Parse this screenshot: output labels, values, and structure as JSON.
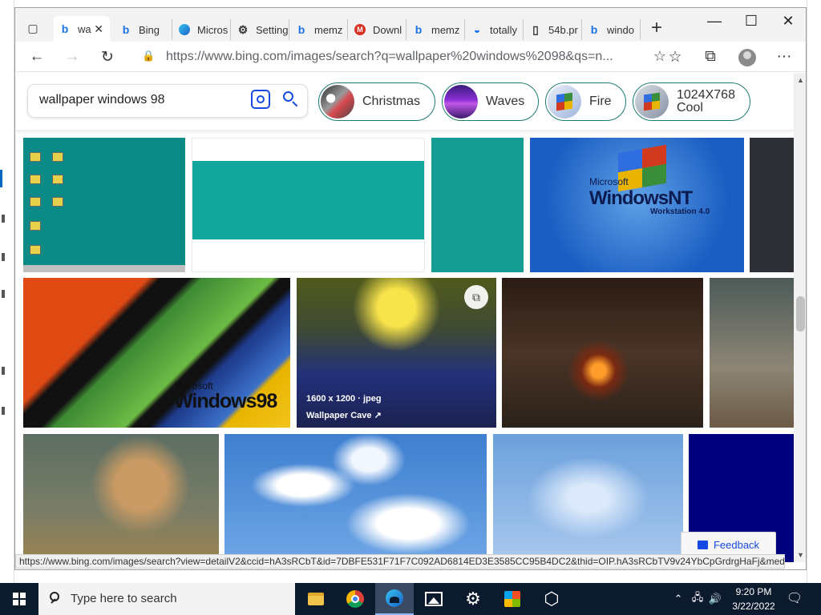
{
  "browser": {
    "tabs": [
      {
        "label": "wa",
        "icon": "bing-icon",
        "active": true,
        "close": "✕"
      },
      {
        "label": "Bing",
        "icon": "bing-icon"
      },
      {
        "label": "Micros",
        "icon": "edge-icon"
      },
      {
        "label": "Setting",
        "icon": "gear-icon"
      },
      {
        "label": "memz",
        "icon": "bing-icon"
      },
      {
        "label": "Downl",
        "icon": "gmail-icon"
      },
      {
        "label": "memz",
        "icon": "bing-icon"
      },
      {
        "label": "totally",
        "icon": "sync-icon"
      },
      {
        "label": "54b.pr",
        "icon": "document-icon"
      },
      {
        "label": "windo",
        "icon": "bing-icon"
      }
    ],
    "new_tab": "+",
    "window_controls": {
      "minimize": "—",
      "maximize": "☐",
      "close": "✕"
    },
    "address": {
      "url": "https://www.bing.com/images/search?q=wallpaper%20windows%2098&qs=n...",
      "lock": "🔒"
    }
  },
  "page": {
    "search": {
      "query": "wallpaper windows 98"
    },
    "chips": [
      {
        "label": "Christmas",
        "thumb": "christmas"
      },
      {
        "label": "Waves",
        "thumb": "waves"
      },
      {
        "label": "Fire",
        "thumb": "fire"
      },
      {
        "label": "1024X768 Cool",
        "line1": "1024X768",
        "line2": "Cool",
        "thumb": "cool"
      }
    ],
    "tiles": {
      "nt": {
        "brand": "Microsoft",
        "title": "WindowsNT",
        "sub": "Workstation 4.0"
      },
      "w98": {
        "brand": "Microsoft",
        "title": "Windows98"
      },
      "hover": {
        "size": "1600 x 1200 · jpeg",
        "source": "Wallpaper Cave"
      }
    },
    "feedback": "Feedback",
    "status_url": "https://www.bing.com/images/search?view=detailV2&ccid=hA3sRCbT&id=7DBFE531F71F7C092AD6814ED3E3585CC95B4DC2&thid=OIP.hA3sRCbTV9v24YbCpGrdrgHaFj&medi..."
  },
  "taskbar": {
    "search_placeholder": "Type here to search",
    "apps": [
      "file-explorer-icon",
      "chrome-icon",
      "edge-icon",
      "photos-icon",
      "settings-icon",
      "store-icon",
      "3d-viewer-icon"
    ],
    "time": "9:20 PM",
    "date": "3/22/2022"
  },
  "colors": {
    "bing_blue": "#174ae4",
    "chip_border": "#1c7a74",
    "taskbar": "#0c1a2e"
  }
}
